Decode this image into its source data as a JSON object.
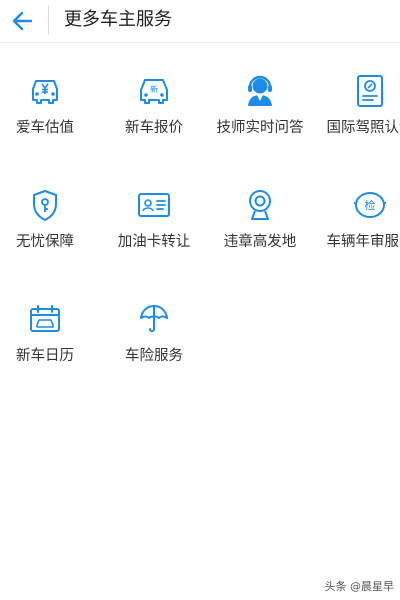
{
  "header": {
    "title": "更多车主服务",
    "back_icon": "arrow-left-icon"
  },
  "theme": {
    "accent": "#1e8ce6"
  },
  "services": [
    {
      "label": "爱车估值",
      "icon": "car-yuan-icon",
      "badge": "¥"
    },
    {
      "label": "新车报价",
      "icon": "car-new-icon",
      "badge": "新"
    },
    {
      "label": "技师实时问答",
      "icon": "technician-icon",
      "badge": ""
    },
    {
      "label": "国际驾照认证",
      "icon": "license-document-icon",
      "badge": ""
    },
    {
      "label": "无忧保障",
      "icon": "shield-icon",
      "badge": ""
    },
    {
      "label": "加油卡转让",
      "icon": "card-icon",
      "badge": ""
    },
    {
      "label": "违章高发地",
      "icon": "camera-icon",
      "badge": ""
    },
    {
      "label": "车辆年审服务",
      "icon": "inspection-icon",
      "badge": "检"
    },
    {
      "label": "新车日历",
      "icon": "calendar-car-icon",
      "badge": ""
    },
    {
      "label": "车险服务",
      "icon": "umbrella-icon",
      "badge": ""
    }
  ],
  "watermark": "头条 @晨星早"
}
